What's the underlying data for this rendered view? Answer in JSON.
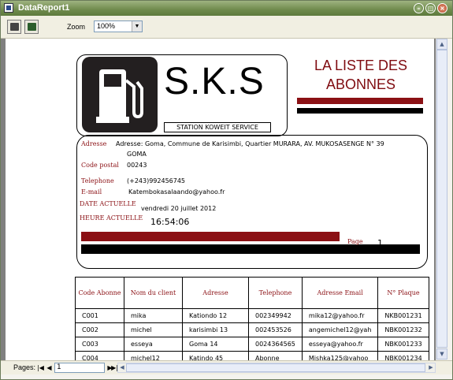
{
  "window": {
    "title": "DataReport1"
  },
  "toolbar": {
    "zoom_label": "Zoom",
    "zoom_value": "100%"
  },
  "status": {
    "pages_label": "Pages:",
    "page_input": "1"
  },
  "report": {
    "logo_text": "S.K.S",
    "station_label": "STATION KOWEIT SERVICE",
    "title_line1": "LA LISTE DES",
    "title_line2": "ABONNES",
    "address_label": "Adresse",
    "address_value_line1": "Adresse: Goma, Commune de Karisimbi, Quartier MURARA, AV. MUKOSASENGE N° 39",
    "address_value_line2": "GOMA",
    "postal_label": "Code postal",
    "postal_value": "00243",
    "phone_label": "Telephone",
    "phone_value": "(+243)992456745",
    "email_label": "E-mail",
    "email_value": "Katembokasalaando@yahoo.fr",
    "date_label": "DATE ACTUELLE",
    "date_value": "vendredi 20 juillet 2012",
    "time_label": "HEURE ACTUELLE",
    "time_value": "16:54:06",
    "page_label": "Page",
    "page_value": "1",
    "accent_color": "#8b1014"
  },
  "table": {
    "headers": [
      "Code Abonne",
      "Nom du client",
      "Adresse",
      "Telephone",
      "Adresse Email",
      "N° Plaque"
    ],
    "rows": [
      [
        "C001",
        "mika",
        "Kationdo 12",
        "002349942",
        "mika12@yahoo.fr",
        "NKB001231"
      ],
      [
        "C002",
        "michel",
        "karisimbi 13",
        "002453526",
        "angemichel12@yah",
        "NBK001232"
      ],
      [
        "C003",
        "esseya",
        "Goma 14",
        "0024364565",
        "esseya@yahoo.fr",
        "NBK001233"
      ],
      [
        "C004",
        "michel12",
        "Katindo 45",
        "Abonne",
        "Mishka125@yahoo",
        "NBK001234"
      ]
    ]
  }
}
